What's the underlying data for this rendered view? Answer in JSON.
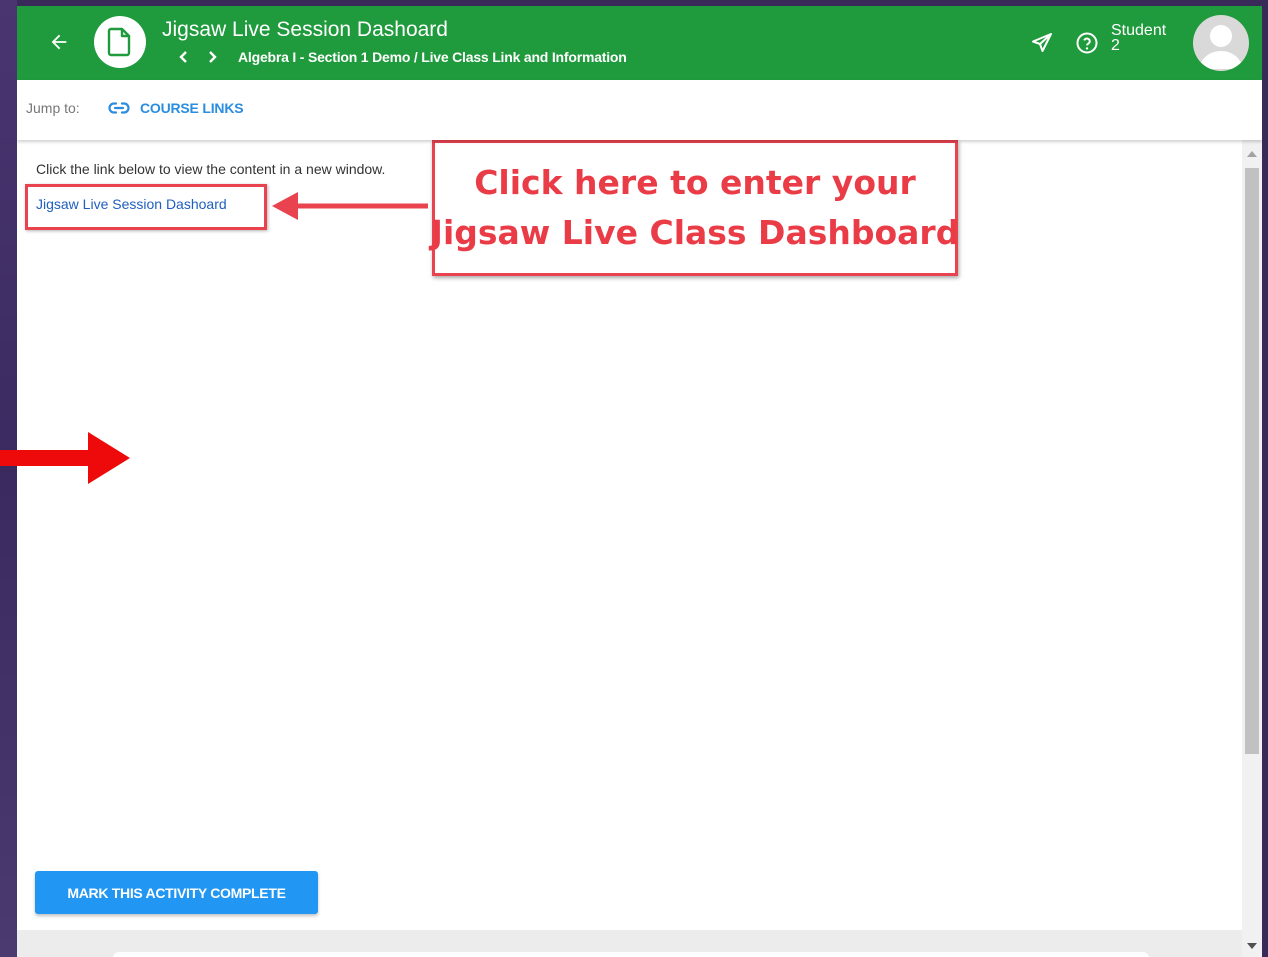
{
  "header": {
    "title": "Jigsaw Live Session Dashoard",
    "breadcrumb": "Algebra I - Section 1 Demo / Live Class Link and Information",
    "user": {
      "line1": "Student",
      "line2": "2"
    },
    "icons": [
      "back-arrow-icon",
      "document-icon",
      "chevron-left-icon",
      "chevron-right-icon",
      "send-icon",
      "help-icon",
      "avatar-icon"
    ],
    "accent": "#1f9a3c"
  },
  "jumpbar": {
    "label": "Jump to:",
    "course_links": "COURSE LINKS",
    "icon": "link-icon"
  },
  "content": {
    "instruction": "Click the link below to view the content in a new window.",
    "link_text": "Jigsaw Live Session Dashoard",
    "callout": {
      "line1": "Click here to enter your",
      "line2": "Jigsaw Live Class Dashboard"
    },
    "complete_button": "MARK THIS ACTIVITY COMPLETE"
  },
  "colors": {
    "annotation_red": "#e8434f",
    "button_blue": "#2196f3",
    "link_blue": "#1f5fbf",
    "arrow_red": "#ee0a0a"
  }
}
